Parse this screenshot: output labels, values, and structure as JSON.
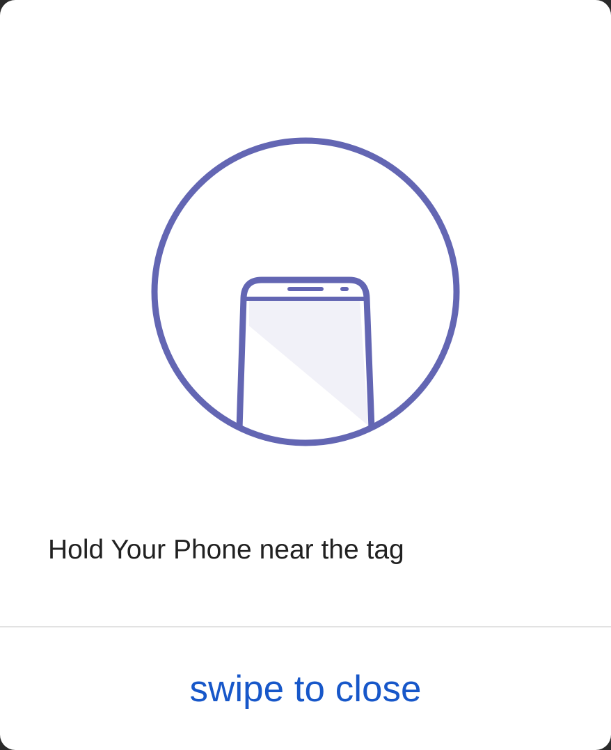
{
  "dialog": {
    "message": "Hold Your Phone near the tag",
    "close_label": "swipe to close"
  },
  "illustration": {
    "icon": "phone-near-tag-icon",
    "accent_color": "#6366b3",
    "screen_tint": "#f1f1f8"
  },
  "colors": {
    "background": "#ffffff",
    "message_text": "#212121",
    "action_text": "#1757c9",
    "divider": "#e2e2e2"
  }
}
